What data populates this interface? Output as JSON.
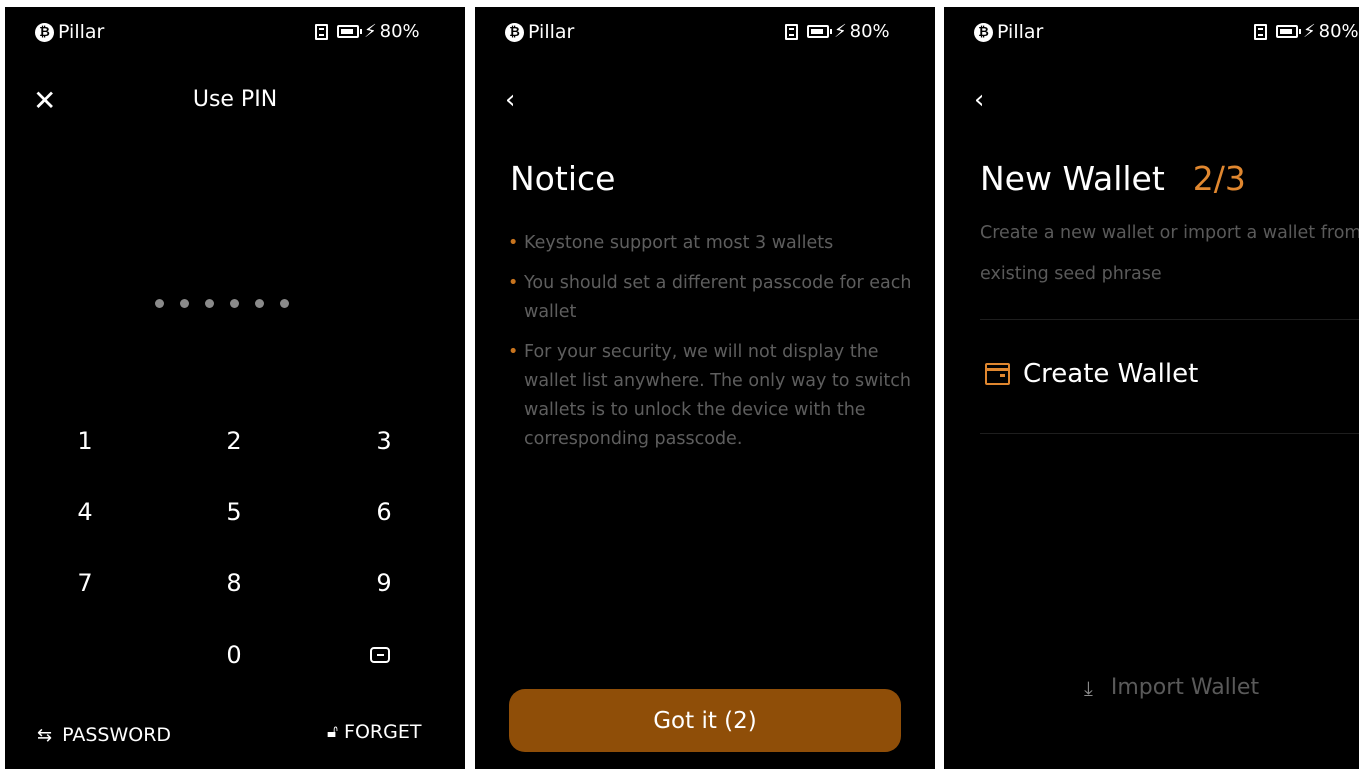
{
  "status_bar": {
    "app_name": "Pillar",
    "battery": "80%",
    "icons": [
      "bitcoin-coin-icon",
      "sd-card-icon",
      "battery-icon",
      "charging-bolt-icon"
    ]
  },
  "screen1": {
    "title": "Use PIN",
    "pin_dots_filled": 6,
    "keys": [
      "1",
      "2",
      "3",
      "4",
      "5",
      "6",
      "7",
      "8",
      "9",
      "0"
    ],
    "password_label": "PASSWORD",
    "forget_label": "FORGET"
  },
  "screen2": {
    "title": "Notice",
    "bullets": [
      "Keystone support at most 3 wallets",
      "You should set a different passcode for each wallet",
      "For your security, we will not display the wallet list anywhere. The only way to switch wallets is to unlock the device with the corresponding passcode."
    ],
    "button_label": "Got it (2)"
  },
  "screen3": {
    "title": "New Wallet",
    "step": "2/3",
    "description": "Create a new wallet or import a wallet from the existing seed phrase",
    "create_label": "Create Wallet",
    "import_label": "Import Wallet"
  },
  "colors": {
    "background": "#000000",
    "accent": "#e0872f",
    "button": "#8f4e08",
    "muted_text": "#5e5e5e"
  }
}
